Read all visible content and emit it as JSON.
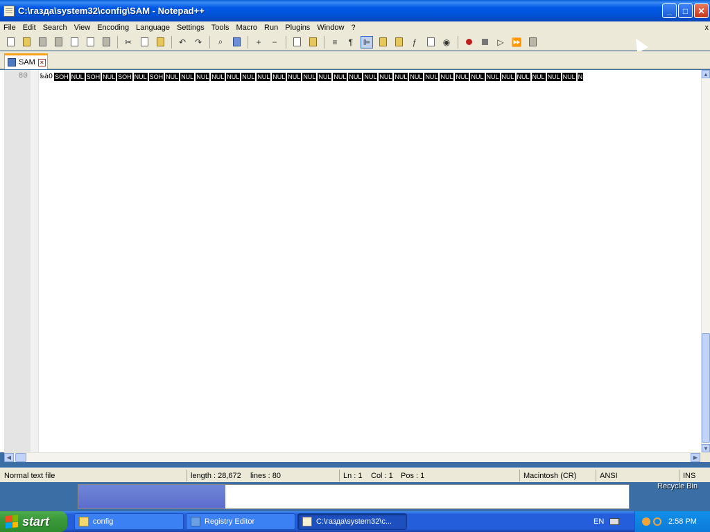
{
  "window": {
    "title": "C:\\газда\\system32\\config\\SAM - Notepad++",
    "minimize": "_",
    "maximize": "□",
    "close": "✕"
  },
  "menu": {
    "items": [
      "File",
      "Edit",
      "Search",
      "View",
      "Encoding",
      "Language",
      "Settings",
      "Tools",
      "Macro",
      "Run",
      "Plugins",
      "Window",
      "?"
    ],
    "close": "x"
  },
  "toolbar": {
    "icons": [
      "new-file-icon",
      "open-file-icon",
      "save-icon",
      "save-all-icon",
      "close-icon",
      "close-all-icon",
      "print-icon",
      "cut-icon",
      "copy-icon",
      "paste-icon",
      "undo-icon",
      "redo-icon",
      "find-icon",
      "replace-icon",
      "zoom-in-icon",
      "zoom-out-icon",
      "sync-v-icon",
      "sync-h-icon",
      "wrap-icon",
      "show-all-chars-icon",
      "indent-guide-icon",
      "user-lang-icon",
      "doc-map-icon",
      "function-list-icon",
      "folder-as-workspace-icon",
      "monitor-icon",
      "record-macro-icon",
      "stop-macro-icon",
      "play-macro-icon",
      "run-multiple-macro-icon",
      "save-macro-icon"
    ]
  },
  "tab": {
    "label": "SAM",
    "accent_color": "#f9a11b"
  },
  "editor": {
    "line_number": "80",
    "plain_prefix": "‰àO",
    "tokens": [
      "SOH",
      "NUL",
      "SOH",
      "NUL",
      "SOH",
      "NUL",
      "SOH",
      "NUL",
      "NUL",
      "NUL",
      "NUL",
      "NUL",
      "NUL",
      "NUL",
      "NUL",
      "NUL",
      "NUL",
      "NUL",
      "NUL",
      "NUL",
      "NUL",
      "NUL",
      "NUL",
      "NUL",
      "NUL",
      "NUL",
      "NUL",
      "NUL",
      "NUL",
      "NUL",
      "NUL",
      "NUL",
      "NUL",
      "NUL",
      "N"
    ]
  },
  "status": {
    "file_type": "Normal text file",
    "length": "length : 28,672",
    "lines": "lines : 80",
    "ln": "Ln : 1",
    "col": "Col : 1",
    "pos": "Pos : 1",
    "eol": "Macintosh (CR)",
    "encoding": "ANSI",
    "mode": "INS"
  },
  "desktop": {
    "recycle_bin": "Recycle Bin"
  },
  "taskbar": {
    "start": "start",
    "tasks": [
      {
        "label": "config",
        "icon": "folder-icon"
      },
      {
        "label": "Registry Editor",
        "icon": "registry-icon"
      },
      {
        "label": "C:\\газда\\system32\\c...",
        "icon": "notepad-icon"
      }
    ],
    "language": "EN",
    "clock": "2:58 PM"
  }
}
